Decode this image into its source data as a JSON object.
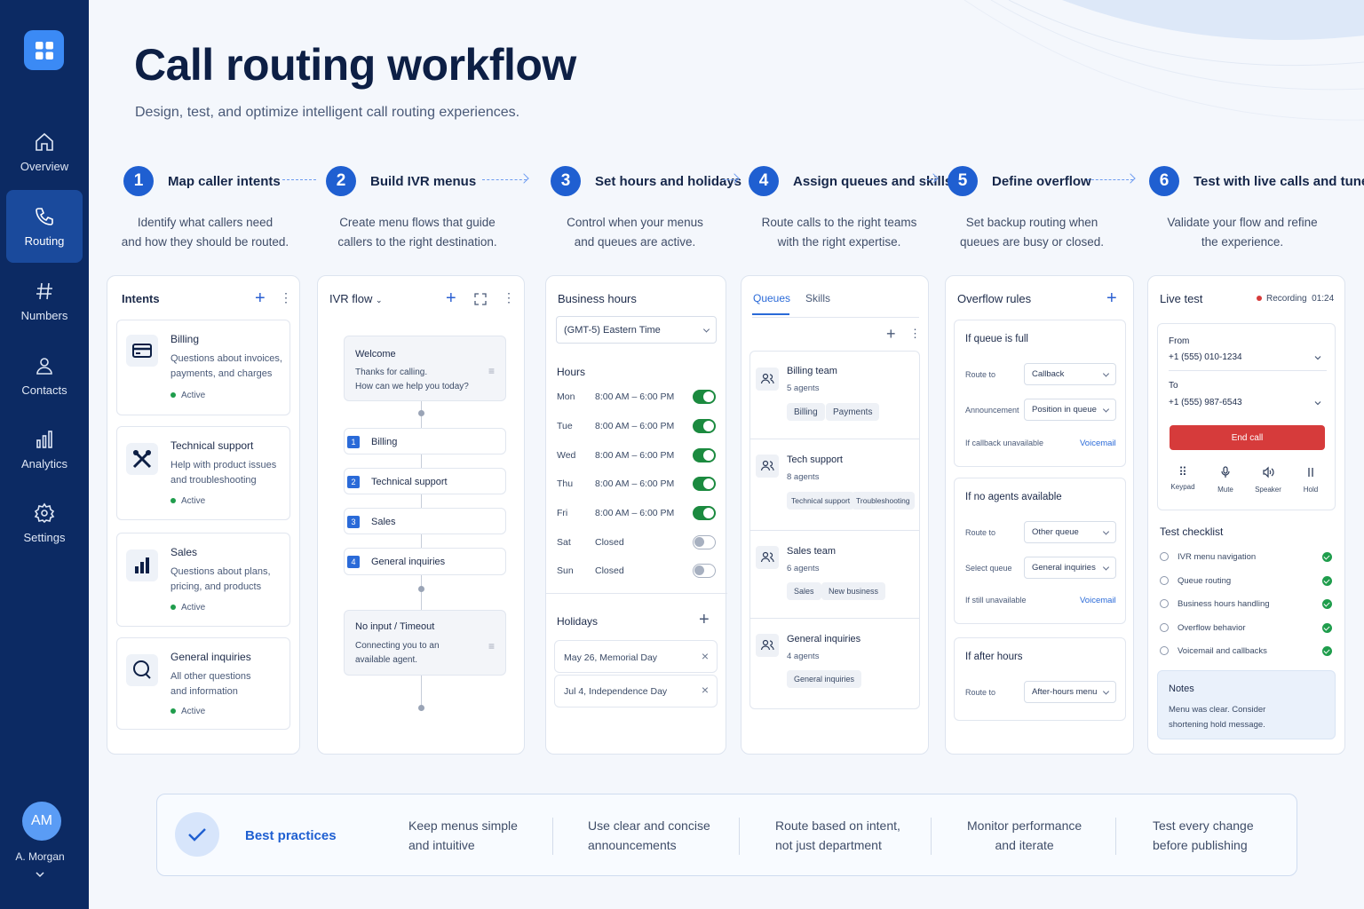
{
  "sidebar": {
    "items": [
      {
        "label": "Overview"
      },
      {
        "label": "Routing"
      },
      {
        "label": "Numbers"
      },
      {
        "label": "Contacts"
      },
      {
        "label": "Analytics"
      },
      {
        "label": "Settings"
      }
    ],
    "user": {
      "initials": "AM",
      "name": "A. Morgan"
    }
  },
  "header": {
    "title": "Call routing workflow",
    "subtitle": "Design, test, and optimize intelligent call routing experiences."
  },
  "steps": [
    {
      "num": "1",
      "title": "Map caller intents",
      "desc1": "Identify what callers need",
      "desc2": "and how they should be routed."
    },
    {
      "num": "2",
      "title": "Build IVR menus",
      "desc1": "Create menu flows that guide",
      "desc2": "callers to the right destination."
    },
    {
      "num": "3",
      "title": "Set hours and holidays",
      "desc1": "Control when your menus",
      "desc2": "and queues are active."
    },
    {
      "num": "4",
      "title": "Assign queues and skills",
      "desc1": "Route calls to the right teams",
      "desc2": "with the right expertise."
    },
    {
      "num": "5",
      "title": "Define overflow",
      "desc1": "Set backup routing when",
      "desc2": "queues are busy or closed."
    },
    {
      "num": "6",
      "title": "Test with live calls and tune",
      "desc1": "Validate your flow and refine",
      "desc2": "the experience."
    }
  ],
  "intents": {
    "title": "Intents",
    "items": [
      {
        "name": "Billing",
        "desc1": "Questions about invoices,",
        "desc2": "payments, and charges",
        "status": "Active",
        "icon": "credit-card-icon"
      },
      {
        "name": "Technical support",
        "desc1": "Help with product issues",
        "desc2": "and troubleshooting",
        "status": "Active",
        "icon": "tools-icon"
      },
      {
        "name": "Sales",
        "desc1": "Questions about plans,",
        "desc2": "pricing, and products",
        "status": "Active",
        "icon": "bar-chart-icon"
      },
      {
        "name": "General inquiries",
        "desc1": "All other questions",
        "desc2": "and information",
        "status": "Active",
        "icon": "chat-bubble-icon"
      }
    ]
  },
  "ivr": {
    "title": "IVR flow",
    "welcome": {
      "title": "Welcome",
      "line1": "Thanks for calling.",
      "line2": "How can we help you today?"
    },
    "options": [
      {
        "num": "1",
        "label": "Billing"
      },
      {
        "num": "2",
        "label": "Technical support"
      },
      {
        "num": "3",
        "label": "Sales"
      },
      {
        "num": "4",
        "label": "General inquiries"
      }
    ],
    "timeout": {
      "title": "No input / Timeout",
      "line1": "Connecting you to an",
      "line2": "available agent."
    }
  },
  "hours": {
    "title": "Business hours",
    "timezone": "(GMT-5) Eastern Time",
    "hours_label": "Hours",
    "days": [
      {
        "day": "Mon",
        "time": "8:00 AM – 6:00 PM",
        "on": true
      },
      {
        "day": "Tue",
        "time": "8:00 AM – 6:00 PM",
        "on": true
      },
      {
        "day": "Wed",
        "time": "8:00 AM – 6:00 PM",
        "on": true
      },
      {
        "day": "Thu",
        "time": "8:00 AM – 6:00 PM",
        "on": true
      },
      {
        "day": "Fri",
        "time": "8:00 AM – 6:00 PM",
        "on": true
      },
      {
        "day": "Sat",
        "time": "Closed",
        "on": false
      },
      {
        "day": "Sun",
        "time": "Closed",
        "on": false
      }
    ],
    "holidays_label": "Holidays",
    "holidays": [
      "May 26, Memorial Day",
      "Jul 4, Independence Day"
    ]
  },
  "queues": {
    "tabs": [
      "Queues",
      "Skills"
    ],
    "items": [
      {
        "name": "Billing team",
        "agents": "5 agents",
        "skills": [
          "Billing",
          "Payments"
        ]
      },
      {
        "name": "Tech support",
        "agents": "8 agents",
        "skills": [
          "Technical support",
          "Troubleshooting"
        ]
      },
      {
        "name": "Sales team",
        "agents": "6 agents",
        "skills": [
          "Sales",
          "New business"
        ]
      },
      {
        "name": "General inquiries",
        "agents": "4 agents",
        "skills": [
          "General inquiries"
        ]
      }
    ]
  },
  "overflow": {
    "title": "Overflow rules",
    "rules": [
      {
        "title": "If queue is full",
        "r1_label": "Route to",
        "r1_value": "Callback",
        "r2_label": "Announcement",
        "r2_value": "Position in queue",
        "r3_label": "If callback unavailable",
        "r3_value": "Voicemail"
      },
      {
        "title": "If no agents available",
        "r1_label": "Route to",
        "r1_value": "Other queue",
        "r2_label": "Select queue",
        "r2_value": "General inquiries",
        "r3_label": "If still unavailable",
        "r3_value": "Voicemail"
      },
      {
        "title": "If after hours",
        "r1_label": "Route to",
        "r1_value": "After-hours menu"
      }
    ]
  },
  "live": {
    "title": "Live test",
    "recording": "Recording",
    "timer": "01:24",
    "from_label": "From",
    "from_value": "+1 (555) 010-1234",
    "to_label": "To",
    "to_value": "+1 (555) 987-6543",
    "end_call": "End call",
    "controls": [
      "Keypad",
      "Mute",
      "Speaker",
      "Hold"
    ],
    "checklist_title": "Test checklist",
    "checklist": [
      "IVR menu navigation",
      "Queue routing",
      "Business hours handling",
      "Overflow behavior",
      "Voicemail and callbacks"
    ],
    "notes_title": "Notes",
    "notes_line1": "Menu was clear. Consider",
    "notes_line2": "shortening hold message."
  },
  "best_practices": {
    "title": "Best practices",
    "items": [
      {
        "l1": "Keep menus simple",
        "l2": "and intuitive"
      },
      {
        "l1": "Use clear and concise",
        "l2": "announcements"
      },
      {
        "l1": "Route based on intent,",
        "l2": "not just department"
      },
      {
        "l1": "Monitor performance",
        "l2": "and iterate"
      },
      {
        "l1": "Test every change",
        "l2": "before publishing"
      }
    ]
  },
  "colors": {
    "sidebar": "#0c2a63",
    "accent": "#1f5fd1",
    "success": "#1b8a3f",
    "danger": "#d63b3b"
  }
}
